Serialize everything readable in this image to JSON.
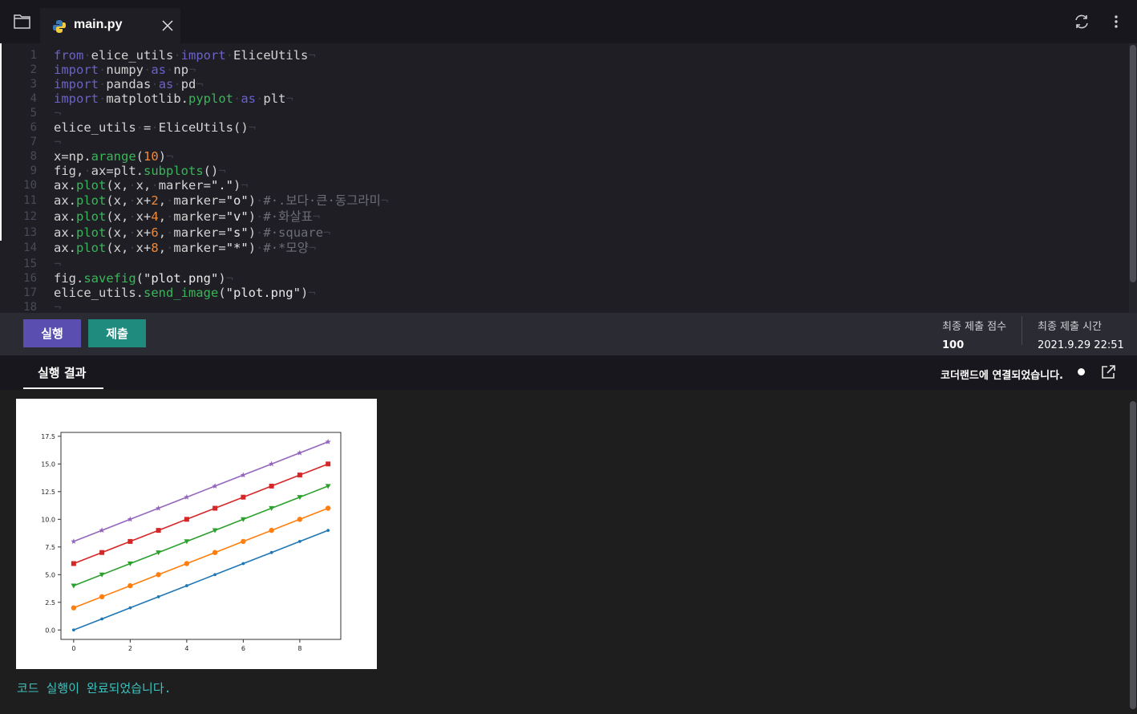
{
  "tab": {
    "filename": "main.py"
  },
  "code_lines": [
    {
      "n": "1",
      "html": "<span class=\"kw\">from</span><span class=\"ws\">·</span>elice_utils<span class=\"ws\">·</span><span class=\"kw\">import</span><span class=\"ws\">·</span>EliceUtils<span class=\"ws\">¬</span>"
    },
    {
      "n": "2",
      "html": "<span class=\"kw\">import</span><span class=\"ws\">·</span>numpy<span class=\"ws\">·</span><span class=\"kw\">as</span><span class=\"ws\">·</span>np<span class=\"ws\">¬</span>"
    },
    {
      "n": "3",
      "html": "<span class=\"kw\">import</span><span class=\"ws\">·</span>pandas<span class=\"ws\">·</span><span class=\"kw\">as</span><span class=\"ws\">·</span>pd<span class=\"ws\">¬</span>"
    },
    {
      "n": "4",
      "html": "<span class=\"kw\">import</span><span class=\"ws\">·</span>matplotlib.<span class=\"fn\">pyplot</span><span class=\"ws\">·</span><span class=\"kw\">as</span><span class=\"ws\">·</span>plt<span class=\"ws\">¬</span>"
    },
    {
      "n": "5",
      "html": "<span class=\"ws\">¬</span>"
    },
    {
      "n": "6",
      "html": "elice_utils<span class=\"ws\">·</span>=<span class=\"ws\">·</span>EliceUtils()<span class=\"ws\">¬</span>"
    },
    {
      "n": "7",
      "html": "<span class=\"ws\">¬</span>"
    },
    {
      "n": "8",
      "html": "x=np.<span class=\"fn\">arange</span>(<span class=\"num\">10</span>)<span class=\"ws\">¬</span>"
    },
    {
      "n": "9",
      "html": "fig,<span class=\"ws\">·</span>ax=plt.<span class=\"fn\">subplots</span>()<span class=\"ws\">¬</span>"
    },
    {
      "n": "10",
      "html": "ax.<span class=\"fn\">plot</span>(x,<span class=\"ws\">·</span>x,<span class=\"ws\">·</span>marker=<span class=\"str\">\".\"</span>)<span class=\"ws\">¬</span>"
    },
    {
      "n": "11",
      "html": "ax.<span class=\"fn\">plot</span>(x,<span class=\"ws\">·</span>x+<span class=\"num\">2</span>,<span class=\"ws\">·</span>marker=<span class=\"str\">\"o\"</span>)<span class=\"ws\">·</span><span class=\"cm\">#·.보다·큰·동그라미</span><span class=\"ws\">¬</span>"
    },
    {
      "n": "12",
      "html": "ax.<span class=\"fn\">plot</span>(x,<span class=\"ws\">·</span>x+<span class=\"num\">4</span>,<span class=\"ws\">·</span>marker=<span class=\"str\">\"v\"</span>)<span class=\"ws\">·</span><span class=\"cm\">#·화살표</span><span class=\"ws\">¬</span>"
    },
    {
      "n": "13",
      "html": "ax.<span class=\"fn\">plot</span>(x,<span class=\"ws\">·</span>x+<span class=\"num\">6</span>,<span class=\"ws\">·</span>marker=<span class=\"str\">\"s\"</span>)<span class=\"ws\">·</span><span class=\"cm\">#·square</span><span class=\"ws\">¬</span>"
    },
    {
      "n": "14",
      "html": "ax.<span class=\"fn\">plot</span>(x,<span class=\"ws\">·</span>x+<span class=\"num\">8</span>,<span class=\"ws\">·</span>marker=<span class=\"str\">\"*\"</span>)<span class=\"ws\">·</span><span class=\"cm\">#·*모양</span><span class=\"ws\">¬</span>"
    },
    {
      "n": "15",
      "html": "<span class=\"ws\">¬</span>"
    },
    {
      "n": "16",
      "html": "fig.<span class=\"fn\">savefig</span>(<span class=\"str\">\"plot.png\"</span>)<span class=\"ws\">¬</span>"
    },
    {
      "n": "17",
      "html": "elice_utils.<span class=\"fn\">send_image</span>(<span class=\"str\">\"plot.png\"</span>)<span class=\"ws\">¬</span>"
    },
    {
      "n": "18",
      "html": "<span class=\"ws\">¬</span>"
    }
  ],
  "actions": {
    "run_label": "실행",
    "submit_label": "제출"
  },
  "stats": {
    "score_label": "최종 제출 점수",
    "score_value": "100",
    "time_label": "최종 제출 시간",
    "time_value": "2021.9.29 22:51"
  },
  "result": {
    "tab_label": "실행 결과",
    "connection_status": "코더랜드에 연결되었습니다.",
    "done_message": "코드 실행이 완료되었습니다."
  },
  "chart_data": {
    "type": "line",
    "x": [
      0,
      1,
      2,
      3,
      4,
      5,
      6,
      7,
      8,
      9
    ],
    "series": [
      {
        "marker": ".",
        "color": "#1f77b4",
        "values": [
          0,
          1,
          2,
          3,
          4,
          5,
          6,
          7,
          8,
          9
        ]
      },
      {
        "marker": "o",
        "color": "#ff7f0e",
        "values": [
          2,
          3,
          4,
          5,
          6,
          7,
          8,
          9,
          10,
          11
        ]
      },
      {
        "marker": "v",
        "color": "#2ca02c",
        "values": [
          4,
          5,
          6,
          7,
          8,
          9,
          10,
          11,
          12,
          13
        ]
      },
      {
        "marker": "s",
        "color": "#d62728",
        "values": [
          6,
          7,
          8,
          9,
          10,
          11,
          12,
          13,
          14,
          15
        ]
      },
      {
        "marker": "*",
        "color": "#9467bd",
        "values": [
          8,
          9,
          10,
          11,
          12,
          13,
          14,
          15,
          16,
          17
        ]
      }
    ],
    "xticks": [
      "0",
      "2",
      "4",
      "6",
      "8"
    ],
    "yticks": [
      "0.0",
      "2.5",
      "5.0",
      "7.5",
      "10.0",
      "12.5",
      "15.0",
      "17.5"
    ],
    "xlim": [
      -0.45,
      9.45
    ],
    "ylim": [
      -0.85,
      17.85
    ],
    "grid": false
  }
}
